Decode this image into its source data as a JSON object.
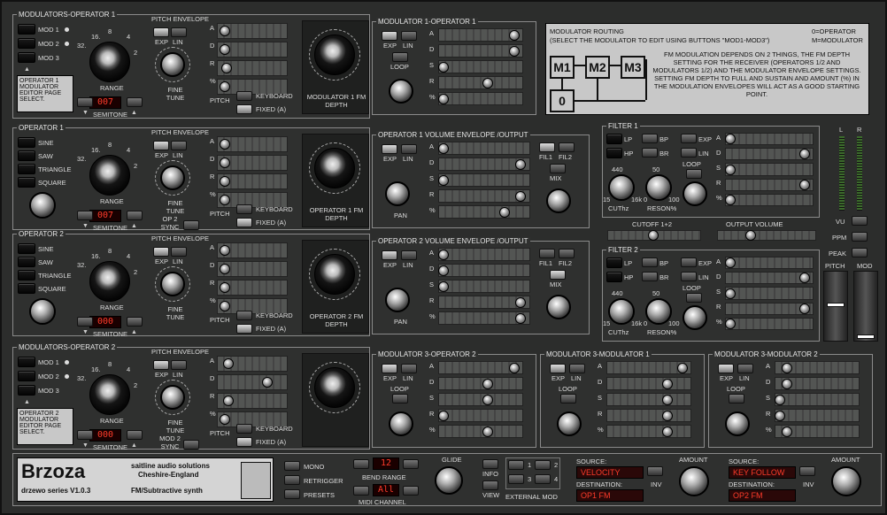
{
  "modop1": {
    "title": "MODULATORS-OPERATOR 1",
    "mods": [
      "MOD 1",
      "MOD 2",
      "MOD 3"
    ],
    "info": "OPERATOR 1 MODULATOR EDITOR PAGE SELECT.",
    "range": "RANGE",
    "semitone": "SEMITONE",
    "semitone_val": "007",
    "fine": "FINE TUNE",
    "fm_depth": "MODULATOR 1 FM DEPTH"
  },
  "op1": {
    "title": "OPERATOR 1",
    "waves": [
      "SINE",
      "SAW",
      "TRIANGLE",
      "SQUARE"
    ],
    "semitone_val": "007",
    "fm_depth": "OPERATOR 1 FM DEPTH",
    "sync": "OP 2 SYNC"
  },
  "op2": {
    "title": "OPERATOR 2",
    "semitone_val": "000",
    "fm_depth": "OPERATOR 2 FM DEPTH"
  },
  "modop2": {
    "title": "MODULATORS-OPERATOR 2",
    "info": "OPERATOR 2 MODULATOR EDITOR PAGE SELECT.",
    "semitone_val": "000",
    "sync": "MOD 2 SYNC"
  },
  "common": {
    "pitch_env": "PITCH ENVELOPE",
    "exp": "EXP",
    "lin": "LIN",
    "adsr": [
      "A",
      "D",
      "R",
      "%"
    ],
    "adsr4": [
      "A",
      "D",
      "S",
      "R",
      "%"
    ],
    "pitch": "PITCH",
    "keyboard": "KEYBOARD",
    "fixed": "FIXED (A)",
    "loop": "LOOP",
    "range_ticks": [
      "16.",
      "8",
      "4",
      "32.",
      "2"
    ]
  },
  "mod1op1": {
    "title": "MODULATOR 1-OPERATOR 1"
  },
  "op1vol": {
    "title": "OPERATOR 1 VOLUME ENVELOPE /OUTPUT",
    "fil1": "FIL1",
    "fil2": "FIL2",
    "mix": "MIX",
    "pan": "PAN"
  },
  "op2vol": {
    "title": "OPERATOR 2 VOLUME ENVELOPE /OUTPUT"
  },
  "routing": {
    "title": "MODULATOR ROUTING",
    "subtitle": "(SELECT THE MODULATOR TO EDIT USING BUTTONS \"MOD1-MOD3\")",
    "legend1": "0=OPERATOR",
    "legend2": "M=MODULATOR",
    "text": "FM MODULATION DEPENDS ON 2 THINGS, THE FM DEPTH SETTING FOR THE RECEIVER (OPERATORS 1/2 AND MODULATORS 1/2) AND THE MODULATOR ENVELOPE SETTINGS. SETTING FM DEPTH TO FULL AND SUSTAIN AND AMOUNT (%) IN THE MODULATION ENVELOPES WILL ACT AS A GOOD STARTING POINT.",
    "m1": "M1",
    "m2": "M2",
    "m3": "M3",
    "o": "0"
  },
  "filter1": {
    "title": "FILTER 1",
    "lp": "LP",
    "hp": "HP",
    "bp": "BP",
    "br": "BR",
    "cut": "CUThz",
    "reson": "RESON%",
    "v440": "440",
    "v15": "15",
    "v16k": "16k",
    "v50": "50",
    "v0": "0",
    "v100": "100"
  },
  "filter2": {
    "title": "FILTER 2"
  },
  "cutoff12": "CUTOFF 1+2",
  "outvol": "OUTPUT VOLUME",
  "meters": {
    "l": "L",
    "r": "R",
    "vu": "VU",
    "ppm": "PPM",
    "peak": "PEAK",
    "pitch": "PITCH",
    "mod": "MOD"
  },
  "mod3op2": {
    "title": "MODULATOR 3-OPERATOR 2"
  },
  "mod3mod1": {
    "title": "MODULATOR 3-MODULATOR 1"
  },
  "mod3mod2": {
    "title": "MODULATOR 3-MODULATOR 2"
  },
  "bottom": {
    "brand": "Brzoza",
    "series": "drzewo series V1.0.3",
    "company": "saitline audio solutions",
    "location": "Cheshire-England",
    "synth": "FM/Subtractive synth",
    "mono": "MONO",
    "retrigger": "RETRIGGER",
    "presets": "PRESETS",
    "bend": "BEND RANGE",
    "bend_val": "12",
    "midi": "MIDI CHANNEL",
    "midi_val": "All",
    "glide": "GLIDE",
    "info": "INFO",
    "view": "VIEW",
    "ext": "EXTERNAL MOD",
    "ext_nums": [
      "1",
      "2",
      "3",
      "4"
    ],
    "source": "SOURCE:",
    "dest": "DESTINATION:",
    "src1": "VELOCITY",
    "dst1": "OP1 FM",
    "src2": "KEY FOLLOW",
    "dst2": "OP2 FM",
    "inv": "INV",
    "amount": "AMOUNT"
  }
}
